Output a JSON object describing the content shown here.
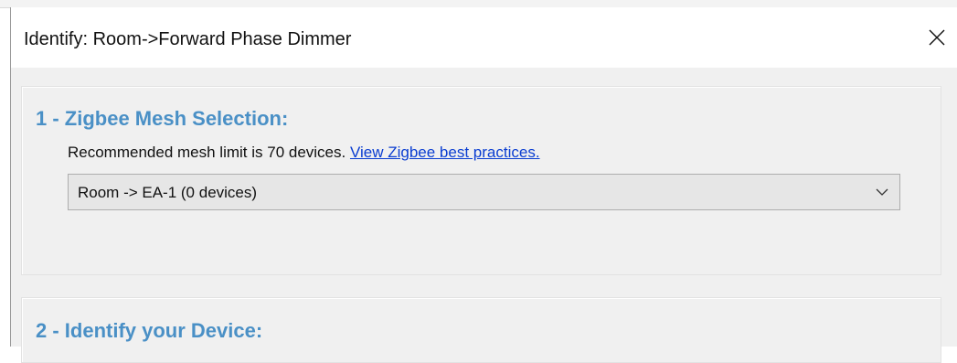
{
  "window": {
    "title": "Identify: Room->Forward Phase Dimmer",
    "close_icon": "close-icon"
  },
  "sections": [
    {
      "heading": "1 - Zigbee Mesh Selection:",
      "description": "Recommended mesh limit is 70 devices. ",
      "link_text": "View Zigbee best practices.",
      "mesh_select": {
        "selected": "Room -> EA-1 (0 devices)",
        "icon": "chevron-down-icon"
      }
    },
    {
      "heading": "2 - Identify your Device:"
    }
  ],
  "colors": {
    "heading": "#4a90c6",
    "link": "#0a3dd1",
    "dialog_background": "#f0f0f0",
    "titlebar": "#ffffff"
  }
}
